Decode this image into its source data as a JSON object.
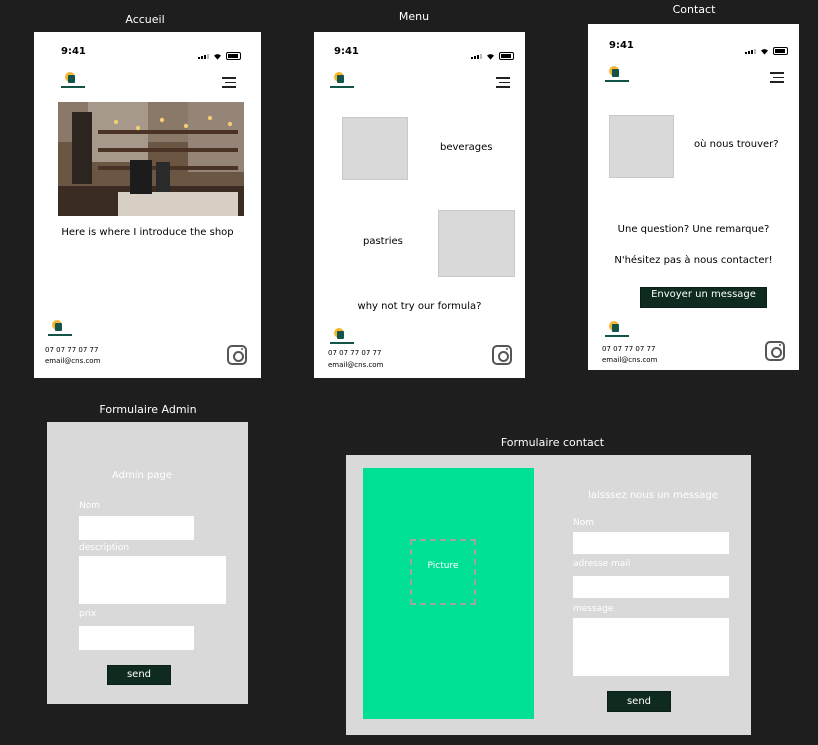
{
  "frames": {
    "accueil": {
      "title": "Accueil",
      "status_time": "9:41",
      "intro_text": "Here is where I introduce the shop",
      "footer": {
        "phone": "07 07 77 07 77",
        "email": "email@cns.com"
      }
    },
    "menu": {
      "title": "Menu",
      "status_time": "9:41",
      "beverages_label": "beverages",
      "pastries_label": "pastries",
      "formula_text": "why not try our formula?",
      "footer": {
        "phone": "07 07 77 07 77",
        "email": "email@cns.com"
      }
    },
    "contact": {
      "title": "Contact",
      "status_time": "9:41",
      "find_us": "où nous trouver?",
      "question_text": "Une question? Une remarque?",
      "contact_text": "N'hésitez pas à nous contacter!",
      "send_message_button": "Envoyer un message",
      "footer": {
        "phone": "07 07 77 07 77",
        "email": "email@cns.com"
      }
    },
    "admin_form": {
      "title": "Formulaire Admin",
      "heading": "Admin page",
      "name_label": "Nom",
      "description_label": "description",
      "price_label": "prix",
      "send_button": "send"
    },
    "contact_form": {
      "title": "Formulaire contact",
      "picture_label": "Picture",
      "heading": "laisssez nous un message",
      "name_label": "Nom",
      "email_label": "adresse mail",
      "message_label": "message",
      "send_button": "send"
    }
  },
  "colors": {
    "background": "#1e1e1e",
    "phone_bg": "#ffffff",
    "placeholder_grey": "#d9d9d9",
    "button_dark": "#0f2b1f",
    "picture_green": "#00e095"
  },
  "icons": [
    "signal-icon",
    "wifi-icon",
    "battery-icon",
    "logo-icon",
    "hamburger-menu-icon",
    "instagram-icon"
  ]
}
